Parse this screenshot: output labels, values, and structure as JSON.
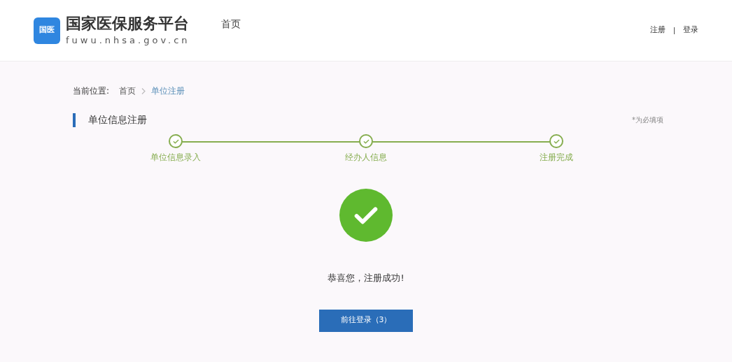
{
  "header": {
    "logo_mark": "国医",
    "logo_title": "国家医保服务平台",
    "logo_subtitle": "fuwu.nhsa.gov.cn",
    "nav": [
      {
        "label": "首页",
        "selected": false
      }
    ],
    "links": [
      "注册",
      "登录"
    ]
  },
  "breadcrumb": {
    "label": "当前位置:",
    "items": [
      {
        "label": "首页",
        "current": false
      },
      {
        "label": "单位注册",
        "current": true
      }
    ]
  },
  "section": {
    "title": "单位信息注册",
    "required_note": "*为必填项"
  },
  "steps": [
    {
      "label": "单位信息录入",
      "done": true
    },
    {
      "label": "经办人信息",
      "done": true
    },
    {
      "label": "注册完成",
      "done": true
    }
  ],
  "result": {
    "success": true,
    "message": "恭喜您，注册成功!",
    "button": "前往登录（3）"
  }
}
